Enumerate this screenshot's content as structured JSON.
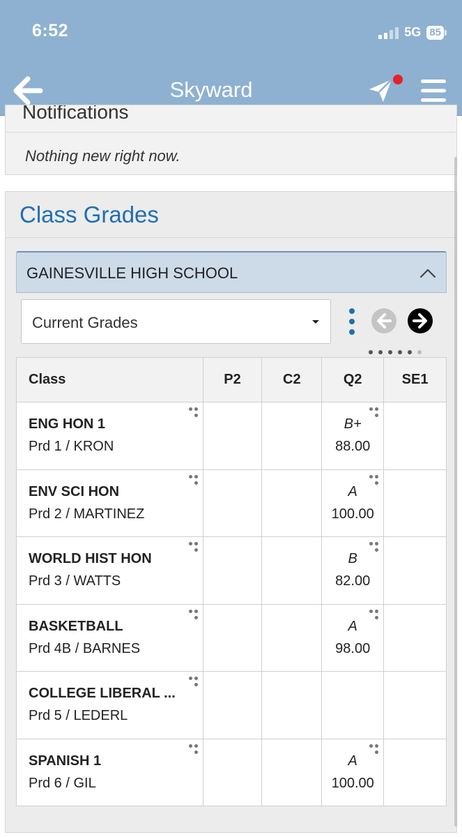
{
  "status_bar": {
    "time": "6:52",
    "network": "5G",
    "battery": "85"
  },
  "header": {
    "title": "Skyward"
  },
  "notifications": {
    "title": "Notifications",
    "message": "Nothing new right now."
  },
  "grades": {
    "title": "Class Grades",
    "school": "GAINESVILLE HIGH SCHOOL",
    "grade_view": "Current Grades",
    "columns": [
      "Class",
      "P2",
      "C2",
      "Q2",
      "SE1"
    ],
    "rows": [
      {
        "class": "ENG HON 1",
        "period": "Prd 1 / KRON",
        "q2_letter": "B+",
        "q2_score": "88.00"
      },
      {
        "class": "ENV SCI HON",
        "period": "Prd 2 / MARTINEZ",
        "q2_letter": "A",
        "q2_score": "100.00"
      },
      {
        "class": "WORLD HIST HON",
        "period": "Prd 3 / WATTS",
        "q2_letter": "B",
        "q2_score": "82.00"
      },
      {
        "class": "BASKETBALL",
        "period": "Prd 4B / BARNES",
        "q2_letter": "A",
        "q2_score": "98.00"
      },
      {
        "class": "COLLEGE LIBERAL ...",
        "period": "Prd 5 / LEDERL",
        "q2_letter": "",
        "q2_score": ""
      },
      {
        "class": "SPANISH 1",
        "period": "Prd 6 / GIL",
        "q2_letter": "A",
        "q2_score": "100.00"
      }
    ]
  },
  "icons": {
    "back": "arrow-left-icon",
    "send": "paper-plane-icon",
    "menu": "hamburger-menu-icon",
    "collapse": "chevron-up-icon",
    "options": "vertical-dots-icon",
    "prev": "arrow-left-circle-icon",
    "next": "arrow-right-circle-icon"
  },
  "colors": {
    "header": "#8eb1d1",
    "accent": "#1f6fb2",
    "notification": "#e8202a"
  }
}
